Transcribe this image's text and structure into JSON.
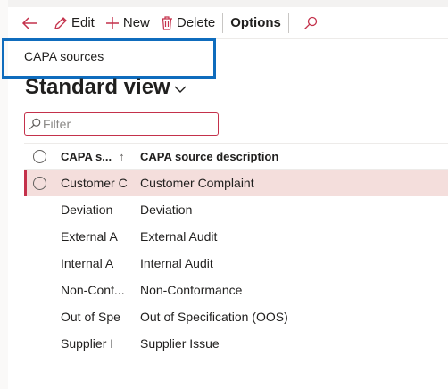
{
  "toolbar": {
    "back_icon": "back-arrow-icon",
    "edit_label": "Edit",
    "new_label": "New",
    "delete_label": "Delete",
    "options_label": "Options",
    "search_icon": "search-icon"
  },
  "caption": "CAPA sources",
  "view": {
    "title": "Standard view"
  },
  "filter": {
    "placeholder": "Filter"
  },
  "grid": {
    "columns": [
      "CAPA s...",
      "CAPA source description"
    ],
    "rows": [
      {
        "id": "Customer C",
        "description": "Customer Complaint",
        "selected": true
      },
      {
        "id": "Deviation",
        "description": "Deviation",
        "selected": false
      },
      {
        "id": "External A",
        "description": "External Audit",
        "selected": false
      },
      {
        "id": "Internal A",
        "description": "Internal Audit",
        "selected": false
      },
      {
        "id": "Non-Conf...",
        "description": "Non-Conformance",
        "selected": false
      },
      {
        "id": "Out of Spe",
        "description": "Out of Specification (OOS)",
        "selected": false
      },
      {
        "id": "Supplier I",
        "description": "Supplier Issue",
        "selected": false
      }
    ]
  },
  "colors": {
    "accent": "#0f6cbd",
    "danger": "#c4314b",
    "selected_row": "#f4dedc"
  }
}
